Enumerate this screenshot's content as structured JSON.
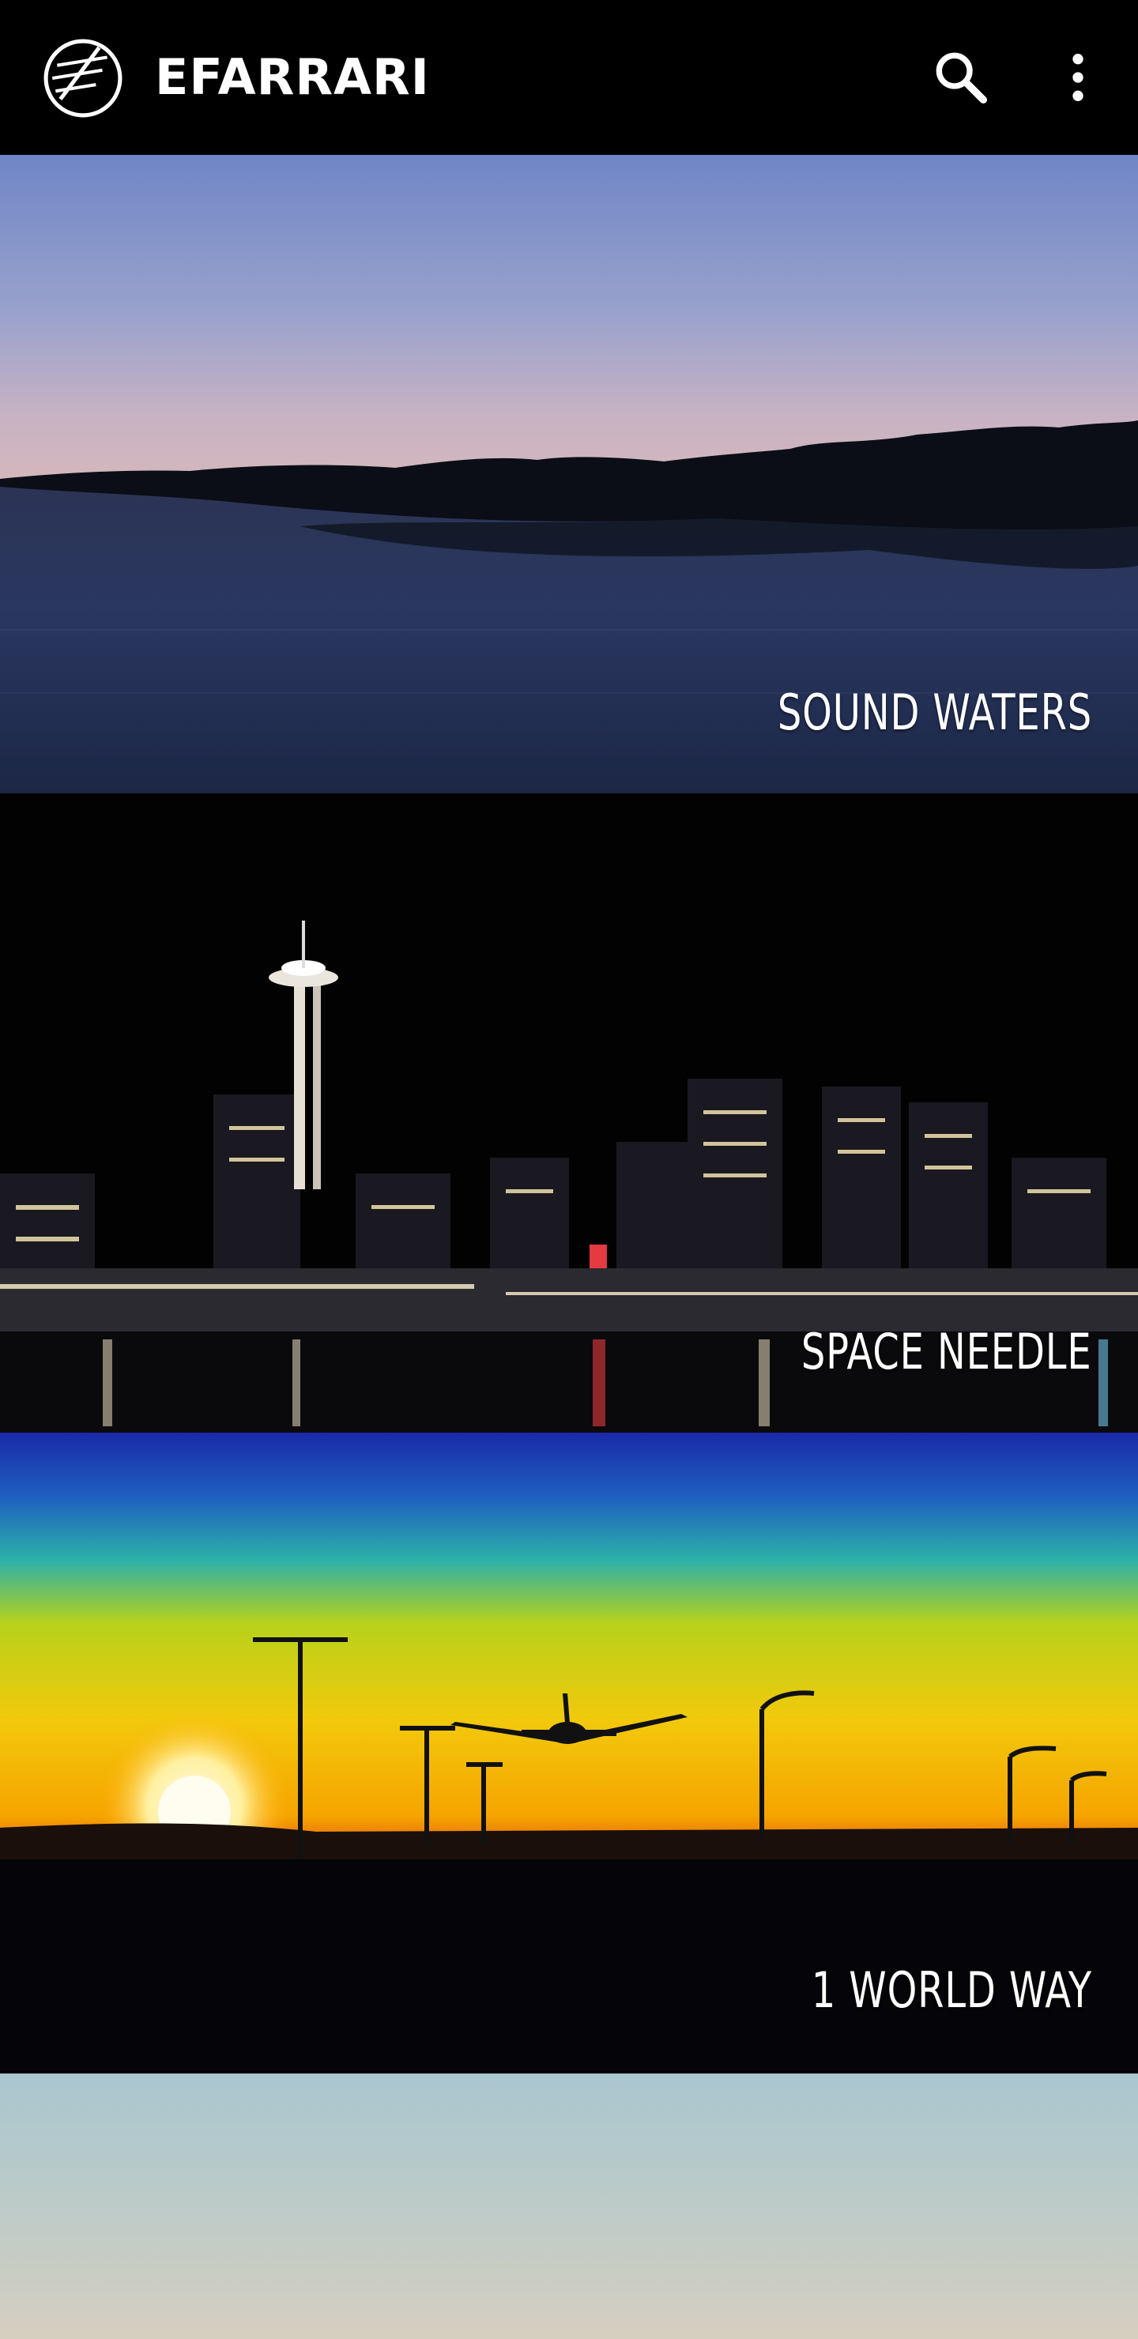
{
  "app": {
    "title": "EFARRARI",
    "logo_icon": "sail-logo-icon",
    "actions": [
      {
        "name": "search",
        "icon": "search-icon"
      },
      {
        "name": "more",
        "icon": "more-vert-icon"
      }
    ]
  },
  "gallery": {
    "items": [
      {
        "caption": "SOUND WATERS"
      },
      {
        "caption": "SPACE NEEDLE"
      },
      {
        "caption": "1 WORLD WAY"
      },
      {
        "caption": ""
      }
    ]
  },
  "colors": {
    "appbar_background": "#000000",
    "text": "#ffffff"
  }
}
